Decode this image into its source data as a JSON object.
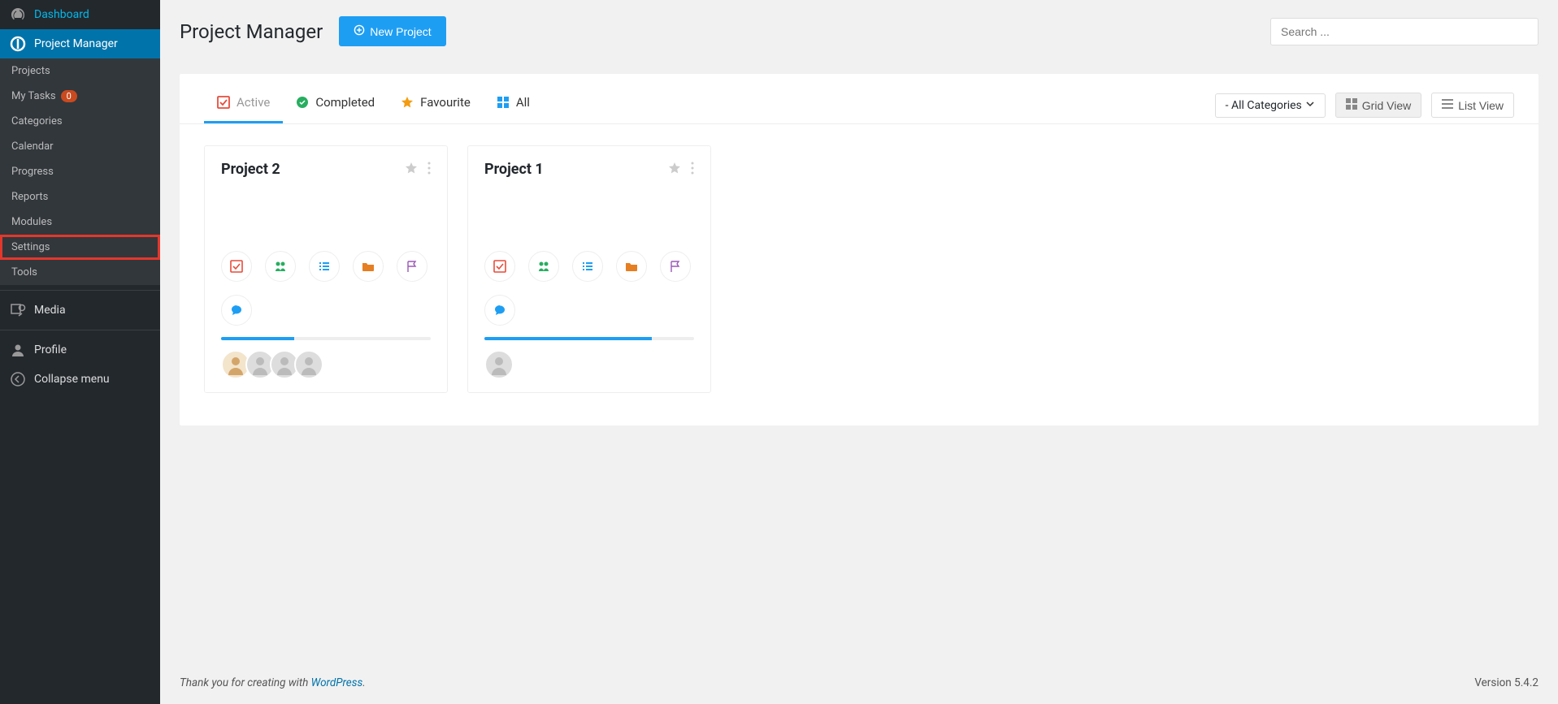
{
  "sidebar": {
    "dashboard": "Dashboard",
    "project_manager": "Project Manager",
    "submenu": {
      "projects": "Projects",
      "my_tasks": "My Tasks",
      "my_tasks_badge": "0",
      "categories": "Categories",
      "calendar": "Calendar",
      "progress": "Progress",
      "reports": "Reports",
      "modules": "Modules",
      "settings": "Settings",
      "tools": "Tools"
    },
    "media": "Media",
    "profile": "Profile",
    "collapse": "Collapse menu"
  },
  "header": {
    "title": "Project Manager",
    "new_project": "New Project",
    "search_placeholder": "Search ..."
  },
  "tabs": {
    "active": "Active",
    "completed": "Completed",
    "favourite": "Favourite",
    "all": "All"
  },
  "filters": {
    "categories": "- All Categories",
    "grid_view": "Grid View",
    "list_view": "List View"
  },
  "projects": [
    {
      "title": "Project 2",
      "progress": 35,
      "avatars": 4
    },
    {
      "title": "Project 1",
      "progress": 80,
      "avatars": 1
    }
  ],
  "footer": {
    "thankyou_prefix": "Thank you for creating with ",
    "wordpress": "WordPress",
    "thankyou_suffix": ".",
    "version_label": "Version ",
    "version": "5.4.2"
  },
  "colors": {
    "primary": "#1e9ef3",
    "sidebar": "#23282d",
    "active": "#0073aa",
    "highlight": "#e3372c"
  }
}
